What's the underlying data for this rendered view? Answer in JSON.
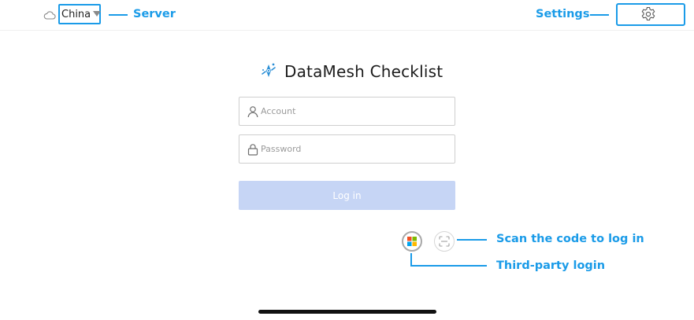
{
  "header": {
    "server": {
      "value": "China",
      "annotation": "Server"
    },
    "settings": {
      "annotation": "Settings"
    }
  },
  "app": {
    "title": "DataMesh Checklist"
  },
  "login_form": {
    "account_placeholder": "Account",
    "password_placeholder": "Password",
    "login_label": "Log in"
  },
  "alt_login": {
    "scan_annotation": "Scan the code to log in",
    "third_party_annotation": "Third-party login"
  },
  "icons": {
    "server": "cloud-icon",
    "settings": "gear-icon",
    "account": "user-icon",
    "password": "lock-icon",
    "third_party": "microsoft-icon",
    "scan": "scan-code-icon"
  },
  "colors": {
    "annotation": "#1a9be8",
    "login_button_disabled": "#c6d5f5",
    "logo": "#2b8fd6"
  }
}
